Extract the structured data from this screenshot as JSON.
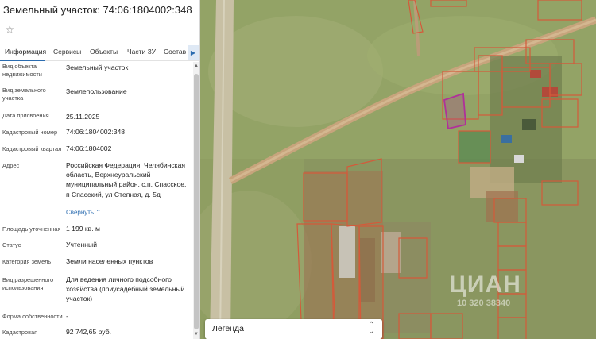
{
  "panel": {
    "title": "Земельный участок: 74:06:1804002:348",
    "favorite_icon": "star-icon",
    "tabs": [
      {
        "label": "Информация"
      },
      {
        "label": "Сервисы"
      },
      {
        "label": "Объекты"
      },
      {
        "label": "Части ЗУ"
      },
      {
        "label": "Состав"
      }
    ],
    "rows": [
      {
        "label": "Вид объекта недвижимости",
        "value": "Земельный участок"
      },
      {
        "label": "Вид земельного участка",
        "value": "Землепользование"
      },
      {
        "label": "Дата присвоения",
        "value": "25.11.2025"
      },
      {
        "label": "Кадастровый номер",
        "value": "74:06:1804002:348"
      },
      {
        "label": "Кадастровый квартал",
        "value": "74:06:1804002"
      },
      {
        "label": "Адрес",
        "value": "Российская Федерация, Челябинская область, Верхнеуральский муниципальный район, с.п. Спасское, п Спасский, ул Степная, д. 5д",
        "toggle": "Свернуть"
      },
      {
        "label": "Площадь уточненная",
        "value": "1 199 кв. м"
      },
      {
        "label": "Статус",
        "value": "Учтенный"
      },
      {
        "label": "Категория земель",
        "value": "Земли населенных пунктов"
      },
      {
        "label": "Вид разрешенного использования",
        "value": "Для ведения личного подсобного хозяйства (приусадебный земельный участок)"
      },
      {
        "label": "Форма собственности",
        "value": "-"
      },
      {
        "label": "Кадастровая",
        "value": "92 742,65 руб."
      }
    ]
  },
  "map": {
    "legend_label": "Легенда",
    "watermark": "ЦИАН",
    "watermark_phone": "10 320 38340",
    "colors": {
      "parcel_border": "#d45a3a",
      "selected_parcel": "#b0309a",
      "field": "#9aa768",
      "road": "#c9a27a"
    }
  }
}
